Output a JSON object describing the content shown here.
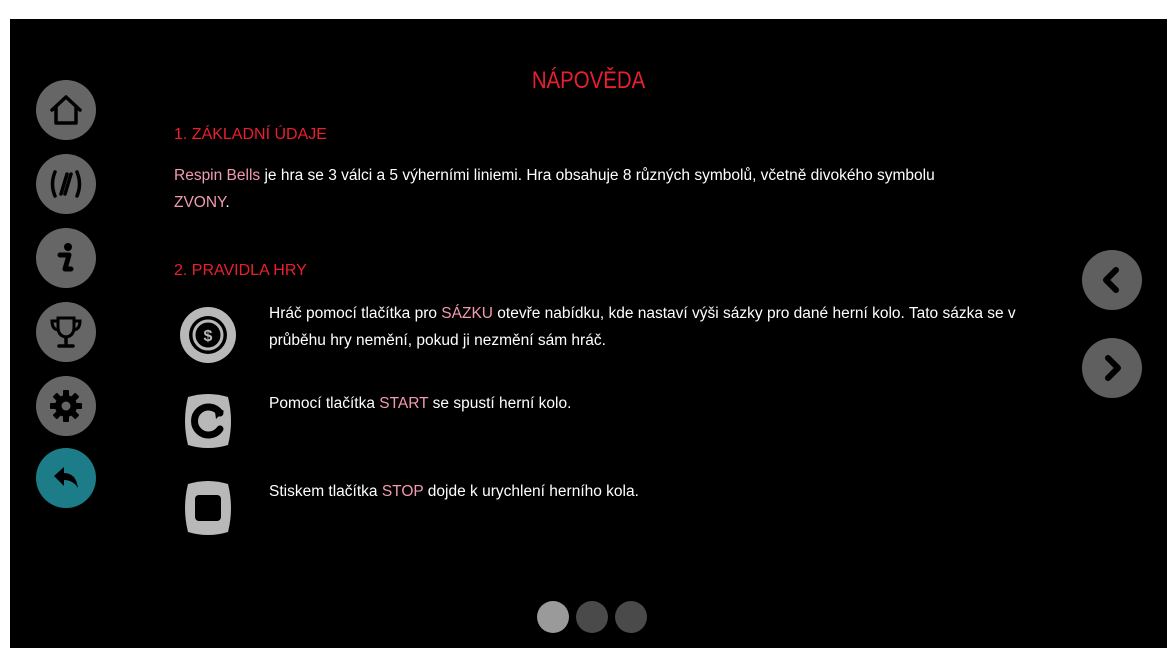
{
  "page": {
    "title": "NÁPOVĚDA"
  },
  "menu": [
    {
      "name": "home-button",
      "icon": "home-icon"
    },
    {
      "name": "paytable-button",
      "icon": "paylines-icon"
    },
    {
      "name": "info-button",
      "icon": "info-icon"
    },
    {
      "name": "trophy-button",
      "icon": "trophy-icon"
    },
    {
      "name": "settings-button",
      "icon": "gear-icon"
    },
    {
      "name": "back-button",
      "icon": "back-arrow-icon",
      "color": "#1c7c88"
    }
  ],
  "section1": {
    "heading": "1. ZÁKLADNÍ ÚDAJE",
    "game_name": "Respin Bells",
    "text_a": " je hra se 3 válci a 5 výherními liniemi. Hra obsahuje 8 různých symbolů, včetně divokého symbolu",
    "wild": "ZVONY",
    "text_b": "."
  },
  "section2": {
    "heading": "2. PRAVIDLA HRY",
    "rules": [
      {
        "icon": "coin-bet-icon",
        "pre": "Hráč pomocí tlačítka pro ",
        "keyword": "SÁZKU",
        "post": " otevře nabídku, kde nastaví výši sázky pro dané herní kolo. Tato sázka se v průběhu hry nemění, pokud ji nezmění sám hráč."
      },
      {
        "icon": "start-spin-icon",
        "pre": "Pomocí tlačítka ",
        "keyword": "START",
        "post": " se spustí herní kolo."
      },
      {
        "icon": "stop-icon",
        "pre": "Stiskem tlačítka ",
        "keyword": "STOP",
        "post": " dojde k urychlení herního kola."
      }
    ]
  },
  "pagination": {
    "pages": 3,
    "current": 1
  },
  "colors": {
    "heading": "#e8202e",
    "highlight": "#f19bb0",
    "button": "#666666",
    "back_button": "#1c7c88",
    "text": "#ffffff"
  }
}
